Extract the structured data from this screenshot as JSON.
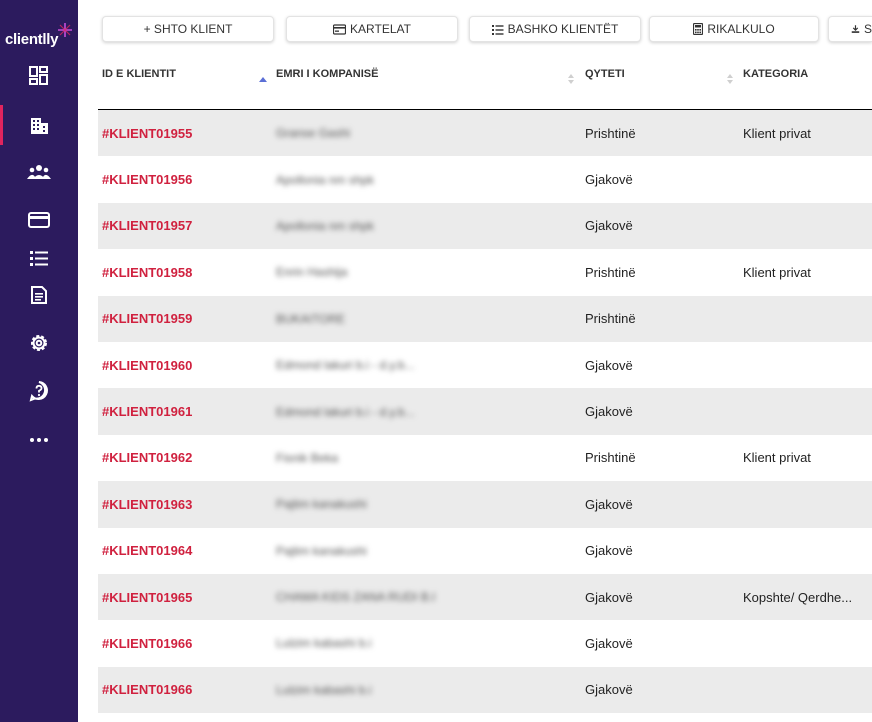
{
  "app": {
    "logo_text": "clientlly"
  },
  "sidebar": {
    "items": [
      {
        "icon": "dashboard-icon",
        "active": false
      },
      {
        "icon": "building-icon",
        "active": true
      },
      {
        "icon": "users-icon",
        "active": false
      },
      {
        "icon": "card-icon",
        "active": false
      },
      {
        "icon": "list-icon",
        "active": false
      },
      {
        "icon": "document-icon",
        "active": false
      },
      {
        "icon": "settings-icon",
        "active": false
      },
      {
        "icon": "help-icon",
        "active": false
      },
      {
        "icon": "more-icon",
        "active": false
      }
    ]
  },
  "toolbar": {
    "add_label": "+ SHTO KLIENT",
    "cards_label": "KARTELAT",
    "merge_label": "BASHKO KLIENTËT",
    "recalc_label": "RIKALKULO",
    "download_label": "S"
  },
  "table": {
    "columns": [
      {
        "label": "ID E KLIENTIT",
        "sort": "asc"
      },
      {
        "label": "EMRI I KOMPANISË",
        "sort": "none"
      },
      {
        "label": "QYTETI",
        "sort": "none"
      },
      {
        "label": "KATEGORIA",
        "sort": "none"
      }
    ],
    "rows": [
      {
        "id": "#KLIENT01955",
        "name": "Granse Gashi",
        "city": "Prishtinë",
        "category": "Klient privat"
      },
      {
        "id": "#KLIENT01956",
        "name": "Apollonia nm shpk",
        "city": "Gjakovë",
        "category": ""
      },
      {
        "id": "#KLIENT01957",
        "name": "Apollonia nm shpk",
        "city": "Gjakovë",
        "category": ""
      },
      {
        "id": "#KLIENT01958",
        "name": "Enrin Hashija",
        "city": "Prishtinë",
        "category": "Klient privat"
      },
      {
        "id": "#KLIENT01959",
        "name": "BUKAITORE",
        "city": "Prishtinë",
        "category": ""
      },
      {
        "id": "#KLIENT01960",
        "name": "Edmond lakuri b.i - d.y.b...",
        "city": "Gjakovë",
        "category": ""
      },
      {
        "id": "#KLIENT01961",
        "name": "Edmond lakuri b.i - d.y.b...",
        "city": "Gjakovë",
        "category": ""
      },
      {
        "id": "#KLIENT01962",
        "name": "Fisnik Beka",
        "city": "Prishtinë",
        "category": "Klient privat"
      },
      {
        "id": "#KLIENT01963",
        "name": "Pajtim kanakushi",
        "city": "Gjakovë",
        "category": ""
      },
      {
        "id": "#KLIENT01964",
        "name": "Pajtim kanakushi",
        "city": "Gjakovë",
        "category": ""
      },
      {
        "id": "#KLIENT01965",
        "name": "CHAMA KIDS ZANA RUDI B.I",
        "city": "Gjakovë",
        "category": "Kopshte/ Qerdhe..."
      },
      {
        "id": "#KLIENT01966",
        "name": "Lulzim kabashi b.i",
        "city": "Gjakovë",
        "category": ""
      },
      {
        "id": "#KLIENT01966",
        "name": "Lulzim kabashi b.i",
        "city": "Gjakovë",
        "category": ""
      }
    ]
  },
  "colors": {
    "sidebar": "#2c1b5e",
    "accent": "#d0213f",
    "active_marker": "#e0245e"
  }
}
